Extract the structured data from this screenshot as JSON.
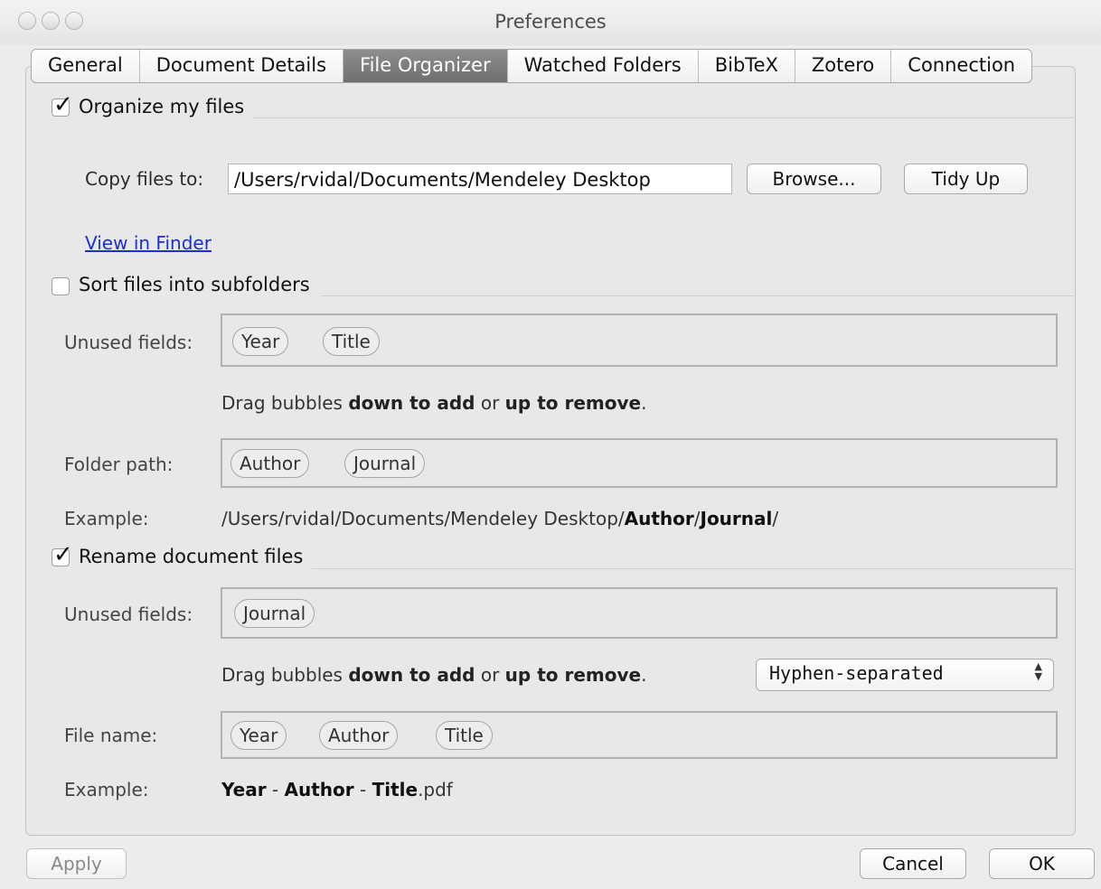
{
  "window": {
    "title": "Preferences"
  },
  "tabs": [
    {
      "label": "General"
    },
    {
      "label": "Document Details"
    },
    {
      "label": "File Organizer",
      "active": true
    },
    {
      "label": "Watched Folders"
    },
    {
      "label": "BibTeX"
    },
    {
      "label": "Zotero"
    },
    {
      "label": "Connection"
    }
  ],
  "organize": {
    "checkbox_label": "Organize my files",
    "checked": true,
    "copy_label": "Copy files to:",
    "path_value": "/Users/rvidal/Documents/Mendeley Desktop",
    "browse_label": "Browse...",
    "tidy_label": "Tidy Up",
    "finder_link": "View in Finder"
  },
  "subfolders": {
    "checkbox_label": "Sort files into subfolders",
    "checked": false,
    "unused_label": "Unused fields:",
    "unused_fields": [
      "Year",
      "Title"
    ],
    "hint_prefix": "Drag bubbles ",
    "hint_down": "down to add",
    "hint_mid": " or ",
    "hint_up": "up to remove",
    "hint_suffix": ".",
    "path_label": "Folder path:",
    "path_fields": [
      "Author",
      "Journal"
    ],
    "example_label": "Example:",
    "example_prefix": "/Users/rvidal/Documents/Mendeley Desktop/",
    "example_bold_1": "Author",
    "example_sep": "/",
    "example_bold_2": "Journal",
    "example_suffix": "/"
  },
  "rename": {
    "checkbox_label": "Rename document files",
    "checked": true,
    "unused_label": "Unused fields:",
    "unused_fields": [
      "Journal"
    ],
    "hint_prefix": "Drag bubbles ",
    "hint_down": "down to add",
    "hint_mid": " or ",
    "hint_up": "up to remove",
    "hint_suffix": ".",
    "separator_select": "Hyphen-separated",
    "filename_label": "File name:",
    "filename_fields": [
      "Year",
      "Author",
      "Title"
    ],
    "example_label": "Example:",
    "example_bold_1": "Year",
    "example_sep": " - ",
    "example_bold_2": "Author",
    "example_bold_3": "Title",
    "example_ext": ".pdf"
  },
  "footer": {
    "apply_label": "Apply",
    "cancel_label": "Cancel",
    "ok_label": "OK"
  }
}
